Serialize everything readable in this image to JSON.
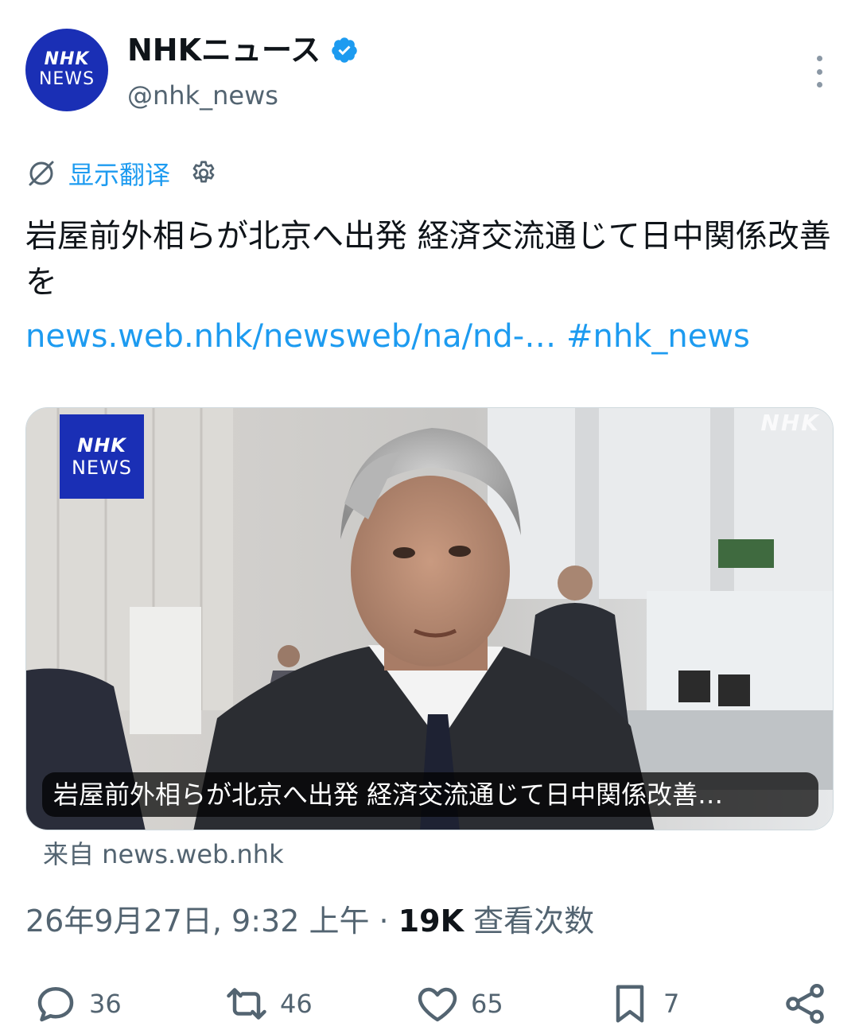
{
  "account": {
    "avatar_line1": "NHK",
    "avatar_line2": "NEWS",
    "display_name": "NHKニュース",
    "handle": "@nhk_news",
    "verified_icon": "verified-badge-icon",
    "verified_color": "#1d9bf0"
  },
  "translate": {
    "label": "显示翻译",
    "icon": "translate-off-icon",
    "settings_icon": "gear-icon"
  },
  "tweet": {
    "text": "岩屋前外相らが北京へ出発 経済交流通じて日中関係改善を",
    "link": "news.web.nhk/newsweb/na/nd-…",
    "hashtag": "#nhk_news"
  },
  "card": {
    "logo_line1": "NHK",
    "logo_line2": "NEWS",
    "watermark": "NHK",
    "caption": "岩屋前外相らが北京へ出発 経済交流通じて日中関係改善…",
    "source": "来自 news.web.nhk"
  },
  "meta": {
    "timestamp": "26年9月27日, 9:32 上午",
    "separator": " · ",
    "views_count": "19K",
    "views_label": " 查看次数"
  },
  "actions": {
    "reply_count": "36",
    "retweet_count": "46",
    "like_count": "65",
    "bookmark_count": "7"
  },
  "colors": {
    "accent": "#1d9bf0",
    "brand_blue": "#1a2fb5",
    "muted": "#536471"
  }
}
